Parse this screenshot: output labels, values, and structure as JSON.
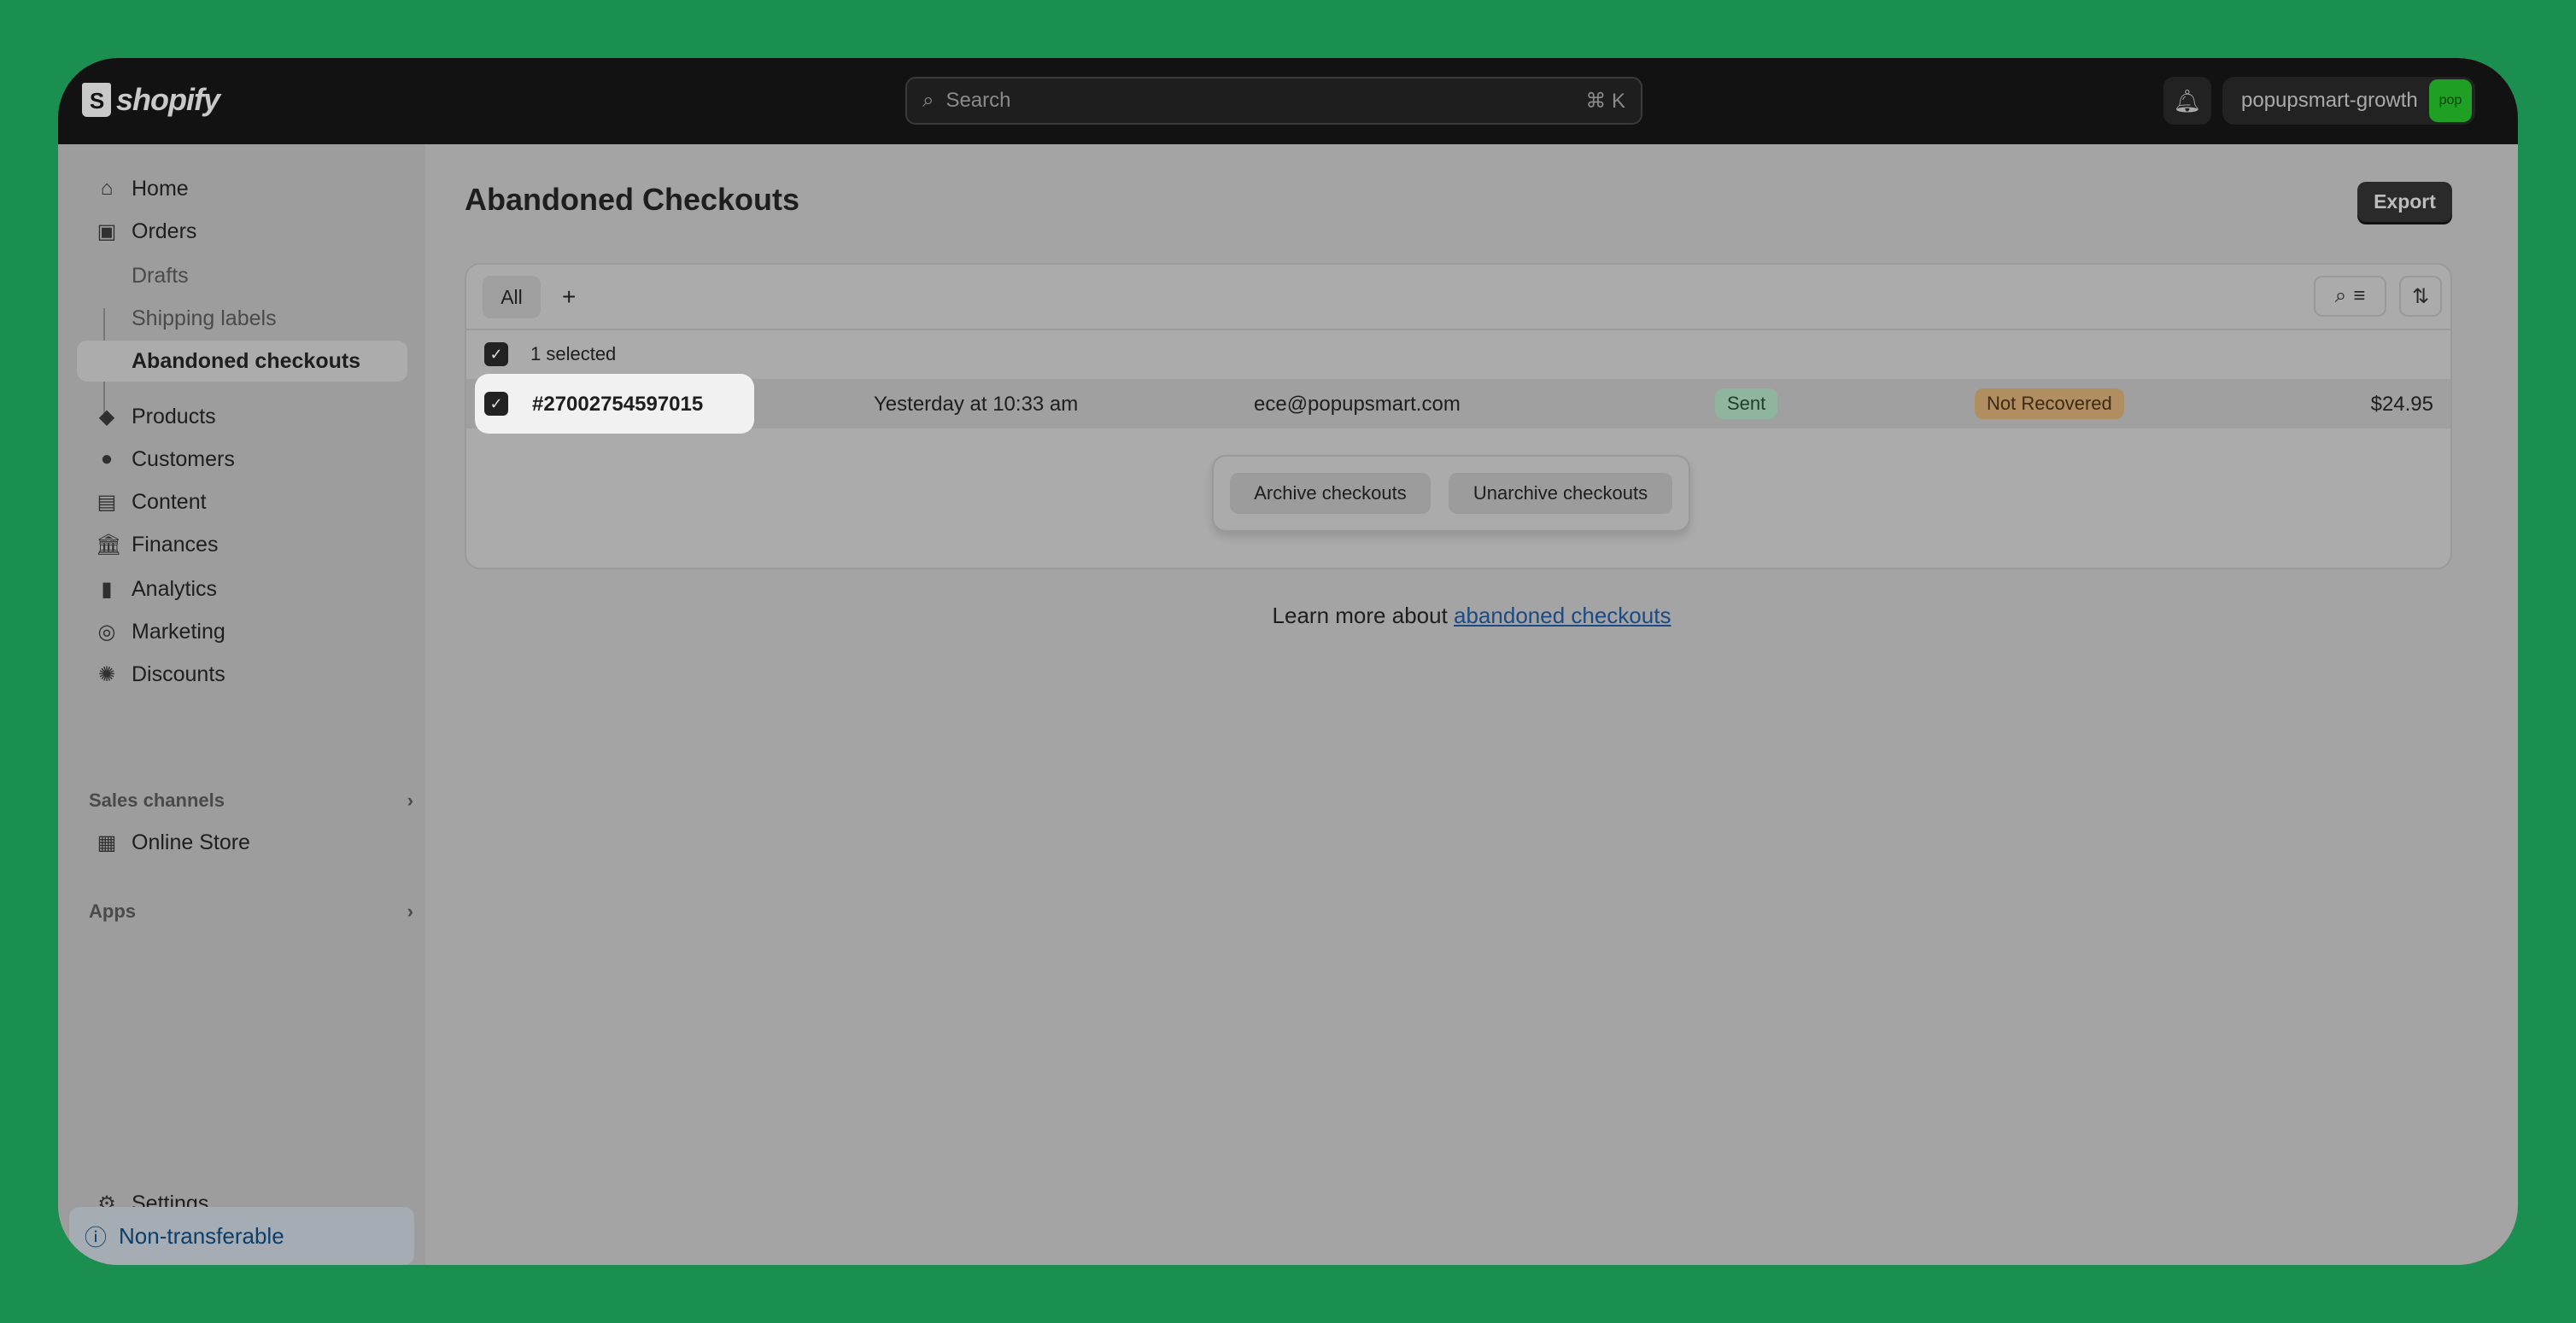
{
  "topbar": {
    "brand": "shopify",
    "search_placeholder": "Search",
    "search_shortcut": "⌘ K",
    "store_name": "popupsmart-growth",
    "avatar_text": "pop",
    "avatar_color": "#1fa024"
  },
  "sidebar": {
    "items": [
      {
        "label": "Home",
        "icon": "home-icon"
      },
      {
        "label": "Orders",
        "icon": "inbox-icon"
      },
      {
        "label": "Drafts"
      },
      {
        "label": "Shipping labels"
      },
      {
        "label": "Abandoned checkouts",
        "active": true
      },
      {
        "label": "Products",
        "icon": "tag-icon"
      },
      {
        "label": "Customers",
        "icon": "person-icon"
      },
      {
        "label": "Content",
        "icon": "image-icon"
      },
      {
        "label": "Finances",
        "icon": "bank-icon"
      },
      {
        "label": "Analytics",
        "icon": "bar-chart-icon"
      },
      {
        "label": "Marketing",
        "icon": "target-icon"
      },
      {
        "label": "Discounts",
        "icon": "discount-icon"
      }
    ],
    "sales_channels": "Sales channels",
    "online_store": "Online Store",
    "apps": "Apps",
    "settings": "Settings",
    "non_transferable": "Non-transferable"
  },
  "main": {
    "title": "Abandoned Checkouts",
    "export_label": "Export",
    "tabs": [
      {
        "label": "All"
      },
      {
        "label": "+"
      }
    ],
    "selected_text": "1 selected",
    "rows": [
      {
        "id": "#27002754597015",
        "date": "Yesterday at 10:33 am",
        "email": "ece@popupsmart.com",
        "email_status": "Sent",
        "recovery_status": "Not Recovered",
        "total": "$24.95",
        "selected": true
      }
    ],
    "bulk_actions": [
      "Archive checkouts",
      "Unarchive checkouts"
    ],
    "learn_prefix": "Learn more about ",
    "learn_link": "abandoned checkouts"
  }
}
